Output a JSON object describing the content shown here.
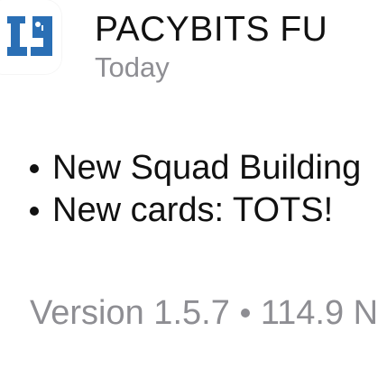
{
  "app": {
    "name": "PACYBITS FU",
    "date": "Today",
    "icon": {
      "name": "pacybits-19-icon",
      "glyph": "19",
      "color": "#2a6fb5"
    }
  },
  "release_notes": [
    "New Squad Building",
    "New cards: TOTS!"
  ],
  "meta": {
    "version": "Version 1.5.7",
    "size": "114.9 N"
  },
  "colors": {
    "primary_text": "#111111",
    "secondary_text": "#8e8e93"
  }
}
